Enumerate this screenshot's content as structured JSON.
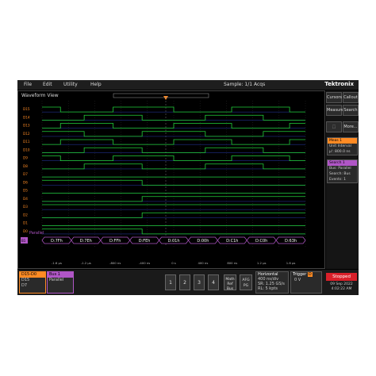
{
  "menu": {
    "items": [
      "File",
      "Edit",
      "Utility",
      "Help"
    ],
    "sample": "Sample: 1/1 Acqs",
    "brand": "Tektronix"
  },
  "waveform_view": {
    "title": "Waveform View",
    "channel_labels": [
      "D15",
      "D14",
      "D13",
      "D12",
      "D11",
      "D10",
      "D9",
      "D8",
      "D7",
      "D6",
      "D5",
      "D4",
      "D3",
      "D2",
      "D1",
      "D0"
    ],
    "bus_label": "Parallel",
    "bus_values": [
      "D:7Fh",
      "D:7Eh",
      "D:FFh",
      "D:FEh",
      "D:01h",
      "D:00h",
      "D:C1h",
      "D:C0h",
      "D:63h"
    ],
    "time_ticks": [
      "-1.6 µs",
      "-1.2 µs",
      "-800 ns",
      "-400 ns",
      "0 s",
      "400 ns",
      "800 ns",
      "1.2 µs",
      "1.6 µs"
    ],
    "bus_marker": "B1"
  },
  "side_panel": {
    "buttons": [
      "Cursors",
      "Callout",
      "Measure",
      "Search",
      "More..."
    ],
    "meas": {
      "title": "Meas 1",
      "lines": [
        "Unit Interval",
        "µ': 800.0 ns"
      ]
    },
    "search": {
      "title": "Search 1",
      "lines": [
        "Bus: Parallel",
        "Search: Bus",
        "Events: 1"
      ]
    }
  },
  "bottom": {
    "digital": {
      "label": "D15-D0",
      "lines": [
        "D15",
        "D7"
      ]
    },
    "bus": {
      "label": "Bus 1",
      "type": "Parallel"
    },
    "channels": [
      "1",
      "2",
      "3",
      "4"
    ],
    "math": "Math Ref Bus",
    "afg": "AFG PG",
    "horizontal": {
      "title": "Horizontal",
      "lines": [
        "400 ns/div",
        "SR: 1.25 GS/s",
        "RL: 5 kpts"
      ]
    },
    "trigger": {
      "title": "Trigger",
      "badge": "D",
      "level": "0 V"
    },
    "status": {
      "label": "Stopped",
      "date": "09 Sep 2022",
      "time": "4:02:22 AM"
    }
  },
  "colors": {
    "digital": "#22d13a",
    "bus": "#b056c6",
    "accent": "#ff8b24",
    "stopped": "#d9202a"
  }
}
